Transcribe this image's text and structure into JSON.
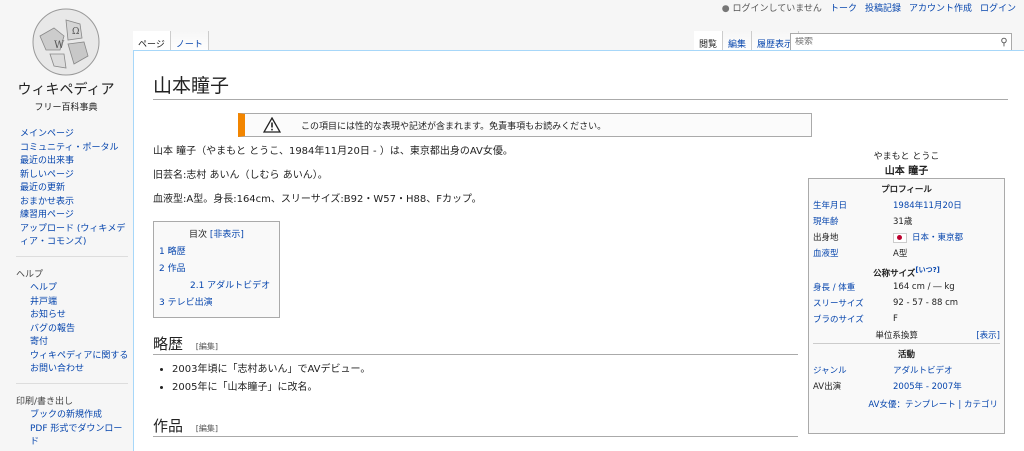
{
  "sidebar": {
    "logo_line1": "ウィキペディア",
    "logo_line2": "フリー百科事典",
    "nav": [
      "メインページ",
      "コミュニティ・ポータル",
      "最近の出来事",
      "新しいページ",
      "最近の更新",
      "おまかせ表示",
      "練習用ページ",
      "アップロード (ウィキメディア・コモンズ)"
    ],
    "help_heading": "ヘルプ",
    "help": [
      "ヘルプ",
      "井戸端",
      "お知らせ",
      "バグの報告",
      "寄付",
      "ウィキペディアに関するお問い合わせ"
    ],
    "print_heading": "印刷/書き出し",
    "print": [
      "ブックの新規作成",
      "PDF 形式でダウンロード"
    ]
  },
  "topbar": {
    "not_logged_in": "ログインしていません",
    "talk": "トーク",
    "contributions": "投稿記録",
    "create_account": "アカウント作成",
    "login": "ログイン"
  },
  "tabs": {
    "page": "ページ",
    "note": "ノート",
    "read": "閲覧",
    "edit": "編集",
    "history": "履歴表示"
  },
  "search": {
    "placeholder": "検索"
  },
  "article": {
    "title": "山本瞳子",
    "notice": "この項目には性的な表現や記述が含まれます。免責事項もお読みください。",
    "p1": "山本 瞳子（やまもと とうこ、1984年11月20日 - ）は、東京都出身のAV女優。",
    "p2": "旧芸名:志村 あいん（しむら あいん）。",
    "p3": "血液型:A型。身長:164cm、スリーサイズ:B92・W57・H88、Fカップ。",
    "toc": {
      "head": "目次",
      "toggle": "[非表示]",
      "items": [
        "1  略歴",
        "2  作品",
        "2.1  アダルトビデオ",
        "3  テレビ出演"
      ]
    },
    "section1": "略歴",
    "edit_link": "[編集]",
    "bullets": [
      "2003年頃に「志村あいん」でAVデビュー。",
      "2005年に「山本瞳子」に改名。"
    ],
    "section2": "作品"
  },
  "infobox": {
    "kana": "やまもと とうこ",
    "name": "山本 瞳子",
    "profile": "プロフィール",
    "rows1": [
      {
        "k": "生年月日",
        "v": "1984年11月20日"
      },
      {
        "k": "現年齢",
        "v": "31歳"
      },
      {
        "k": "出身地",
        "v": "日本・東京都"
      },
      {
        "k": "血液型",
        "v": "A型"
      }
    ],
    "size_head": "公称サイズ",
    "size_when": "[いつ?]",
    "rows2": [
      {
        "k": "身長 / 体重",
        "v": "164 cm / ― kg"
      },
      {
        "k": "スリーサイズ",
        "v": "92 - 57 - 88 cm"
      },
      {
        "k": "ブラのサイズ",
        "v": "F"
      }
    ],
    "unit_conv": "単位系換算",
    "show": "[表示]",
    "activity": "活動",
    "rows3": [
      {
        "k": "ジャンル",
        "v": "アダルトビデオ"
      },
      {
        "k": "AV出演",
        "v": "2005年 - 2007年"
      }
    ],
    "footer": "AV女優：テンプレート | カテゴリ"
  }
}
